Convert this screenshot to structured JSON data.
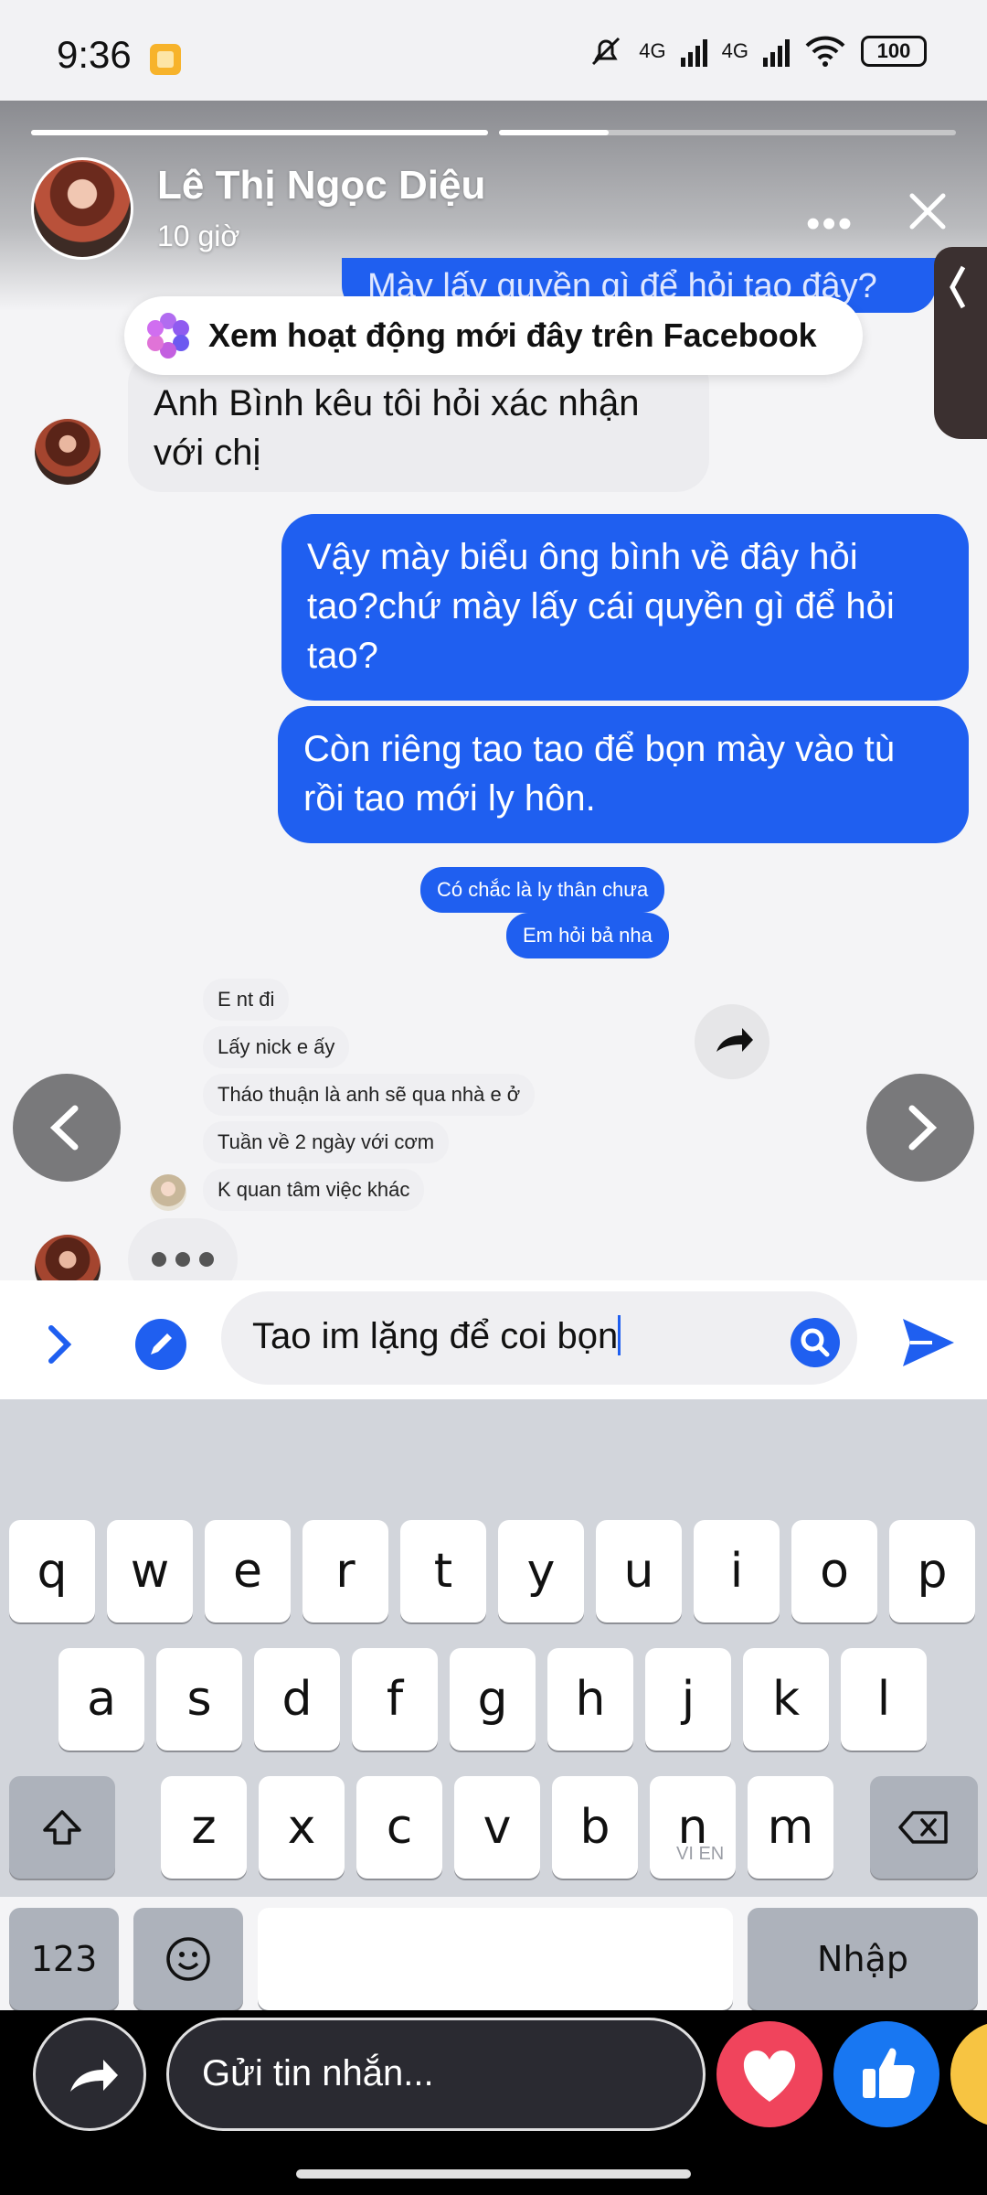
{
  "status_bar": {
    "time": "9:36",
    "net1": "4G",
    "net2": "4G",
    "battery": "100"
  },
  "story": {
    "author": "Lê Thị Ngọc Diệu",
    "posted": "10 giờ",
    "more_label": "•••"
  },
  "chat": {
    "top_cut_text": "Mày lấy quyền gì để hỏi tao đây?",
    "fb_pill": "Xem hoạt động mới đây trên Facebook",
    "received_1": [
      "Anh Bình kêu tôi hỏi xác nhận",
      "với chị"
    ],
    "sent_1": [
      "Vậy mày biểu ông bình về đây hỏi",
      "tao?chứ mày lấy cái quyền gì để hỏi",
      "tao?"
    ],
    "sent_2": [
      "Còn riêng tao tao để bọn mày vào tù",
      "rồi tao mới ly hôn."
    ],
    "inner_sent": [
      "Có chắc là ly thân chưa",
      "Em hỏi bả nha"
    ],
    "inner_received": [
      "E nt đi",
      "Lấy nick e ấy",
      "Tháo thuận là anh sẽ qua nhà e ở",
      "Tuần về 2 ngày với cơm",
      "K quan tâm việc khác"
    ]
  },
  "composer": {
    "text": "Tao im lặng để coi bọn"
  },
  "keyboard": {
    "row1": [
      "q",
      "w",
      "e",
      "r",
      "t",
      "y",
      "u",
      "i",
      "o",
      "p"
    ],
    "row2": [
      "a",
      "s",
      "d",
      "f",
      "g",
      "h",
      "j",
      "k",
      "l"
    ],
    "row3": [
      "z",
      "x",
      "c",
      "v",
      "b",
      "n",
      "m"
    ],
    "numbers_key": "123",
    "enter_key": "Nhập",
    "lang_hint": "VI EN"
  },
  "reply": {
    "placeholder": "Gửi tin nhắn..."
  },
  "colors": {
    "messenger_blue": "#1f5ff0",
    "love_red": "#f0445c",
    "like_blue": "#1877f2"
  }
}
